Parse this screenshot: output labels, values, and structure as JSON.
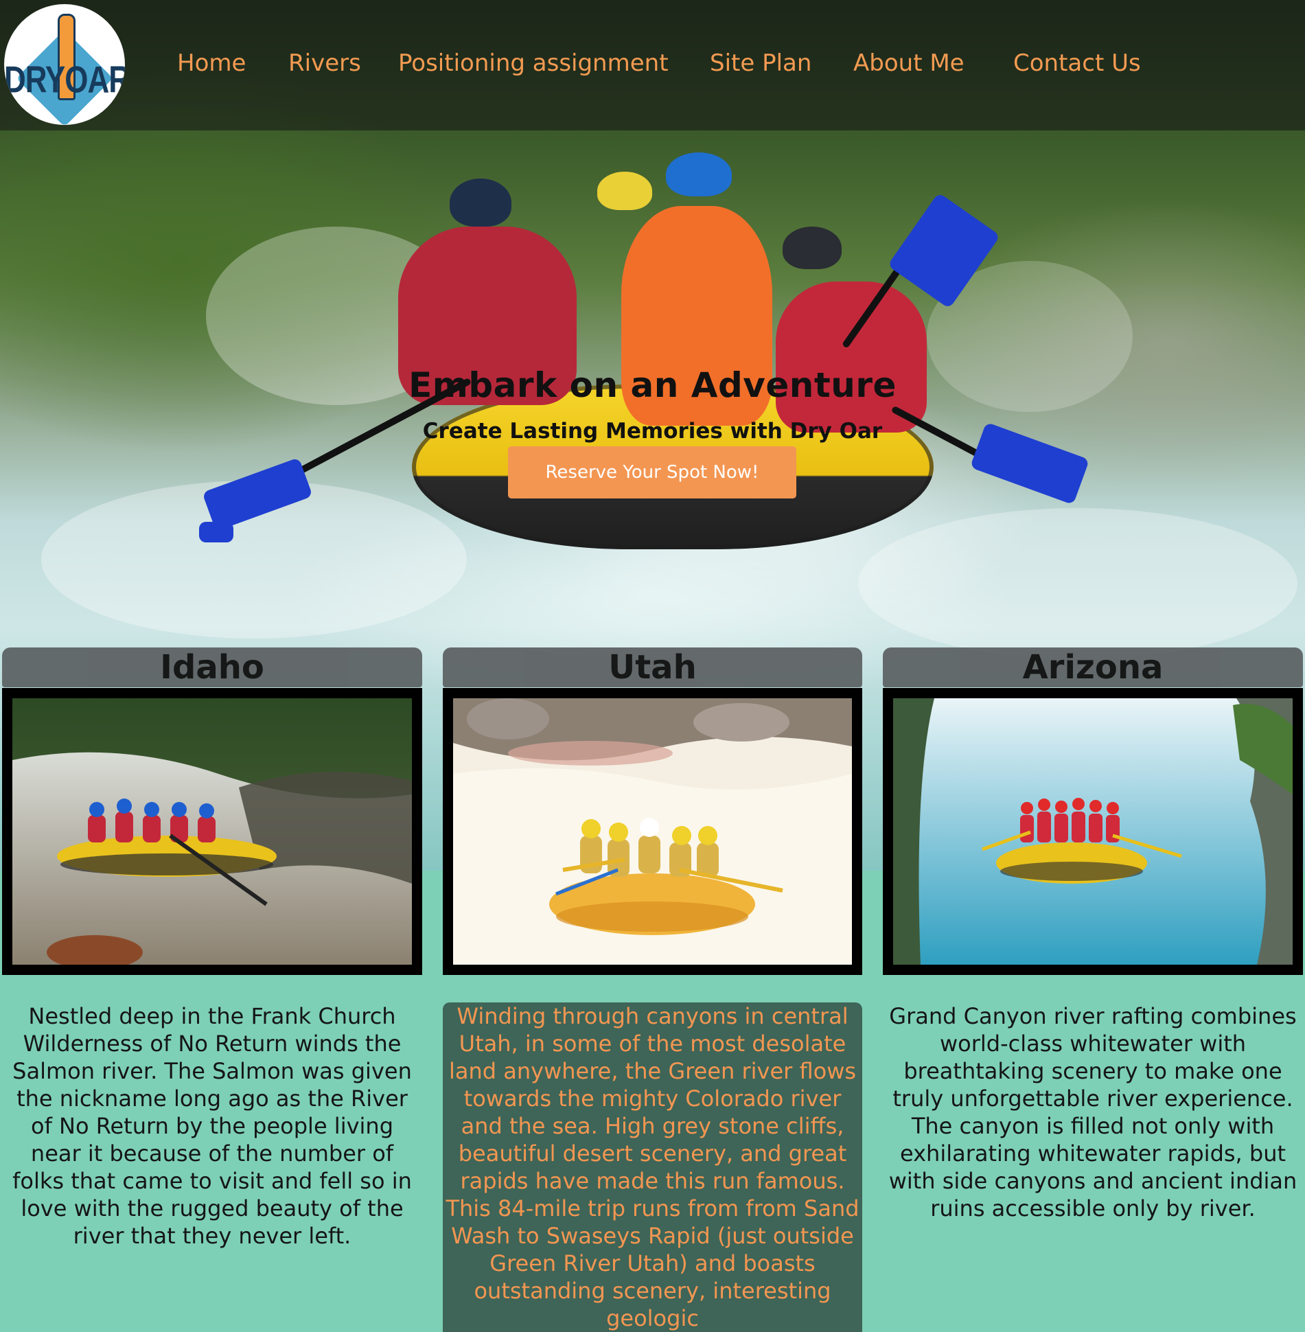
{
  "brand": {
    "logo_text": "DRYOAR"
  },
  "nav": {
    "items": [
      {
        "label": "Home"
      },
      {
        "label": "Rivers"
      },
      {
        "label": "Positioning assignment"
      },
      {
        "label": "Site Plan"
      },
      {
        "label": "About Me"
      },
      {
        "label": "Contact Us"
      }
    ]
  },
  "hero": {
    "title": "Embark on an Adventure",
    "subtitle": "Create Lasting Memories with Dry Oar",
    "cta_label": "Reserve Your Spot Now!"
  },
  "cards": [
    {
      "title": "Idaho",
      "text": "Nestled deep in the Frank Church Wilderness of No Return winds the Salmon river. The Salmon was given the nickname long ago as the River of No Return by the people living near it because of the number of folks that came to visit and fell so in love with the rugged beauty of the river that they never left."
    },
    {
      "title": "Utah",
      "text": "Winding through canyons in central Utah, in some of the most desolate land anywhere, the Green river flows towards the mighty Colorado river and the sea. High grey stone cliffs, beautiful desert scenery, and great rapids have made this run famous. This 84-mile trip runs from from Sand Wash to Swaseys Rapid (just outside Green River Utah) and boasts outstanding scenery, interesting geologic"
    },
    {
      "title": "Arizona",
      "text": "Grand Canyon river rafting combines world-class whitewater with breathtaking scenery to make one truly unforgettable river experience. The canyon is filled not only with exhilarating whitewater rapids, but with side canyons and ancient indian ruins accessible only by river."
    }
  ],
  "colors": {
    "accent": "#f39652",
    "page_bg": "#7dd0b6",
    "featured_card_bg": "#3e6557",
    "card_head_bg": "#5e6365"
  }
}
